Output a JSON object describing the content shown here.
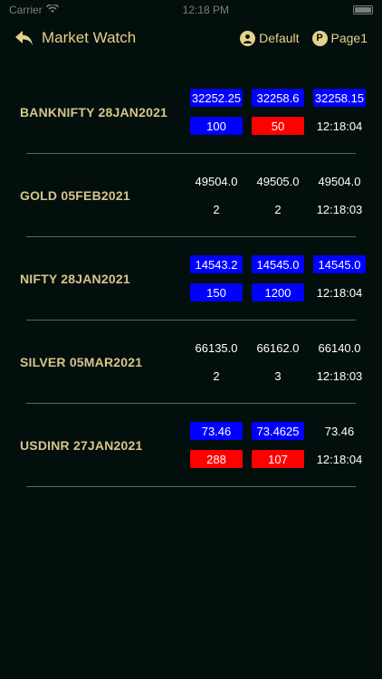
{
  "status_bar": {
    "carrier": "Carrier",
    "time": "12:18 PM"
  },
  "header": {
    "title": "Market Watch",
    "profile_label": "Default",
    "page_label": "Page1",
    "page_icon_letter": "P"
  },
  "colors": {
    "background": "#030f0d",
    "accent": "#e4d18a",
    "up": "#0000ff",
    "down": "#ff0000",
    "divider": "#5c6661"
  },
  "rows": [
    {
      "name": "BANKNIFTY 28JAN2021",
      "cells": [
        {
          "value": "32252.25",
          "style": "blue"
        },
        {
          "value": "32258.6",
          "style": "blue"
        },
        {
          "value": "32258.15",
          "style": "blue"
        },
        {
          "value": "100",
          "style": "blue"
        },
        {
          "value": "50",
          "style": "red"
        },
        {
          "value": "12:18:04",
          "style": "plain"
        }
      ]
    },
    {
      "name": "GOLD 05FEB2021",
      "cells": [
        {
          "value": "49504.0",
          "style": "plain"
        },
        {
          "value": "49505.0",
          "style": "plain"
        },
        {
          "value": "49504.0",
          "style": "plain"
        },
        {
          "value": "2",
          "style": "plain"
        },
        {
          "value": "2",
          "style": "plain"
        },
        {
          "value": "12:18:03",
          "style": "plain"
        }
      ]
    },
    {
      "name": "NIFTY 28JAN2021",
      "cells": [
        {
          "value": "14543.2",
          "style": "blue"
        },
        {
          "value": "14545.0",
          "style": "blue"
        },
        {
          "value": "14545.0",
          "style": "blue"
        },
        {
          "value": "150",
          "style": "blue"
        },
        {
          "value": "1200",
          "style": "blue"
        },
        {
          "value": "12:18:04",
          "style": "plain"
        }
      ]
    },
    {
      "name": "SILVER 05MAR2021",
      "cells": [
        {
          "value": "66135.0",
          "style": "plain"
        },
        {
          "value": "66162.0",
          "style": "plain"
        },
        {
          "value": "66140.0",
          "style": "plain"
        },
        {
          "value": "2",
          "style": "plain"
        },
        {
          "value": "3",
          "style": "plain"
        },
        {
          "value": "12:18:03",
          "style": "plain"
        }
      ]
    },
    {
      "name": "USDINR 27JAN2021",
      "cells": [
        {
          "value": "73.46",
          "style": "blue"
        },
        {
          "value": "73.4625",
          "style": "blue"
        },
        {
          "value": "73.46",
          "style": "plain"
        },
        {
          "value": "288",
          "style": "red"
        },
        {
          "value": "107",
          "style": "red"
        },
        {
          "value": "12:18:04",
          "style": "plain"
        }
      ]
    }
  ]
}
